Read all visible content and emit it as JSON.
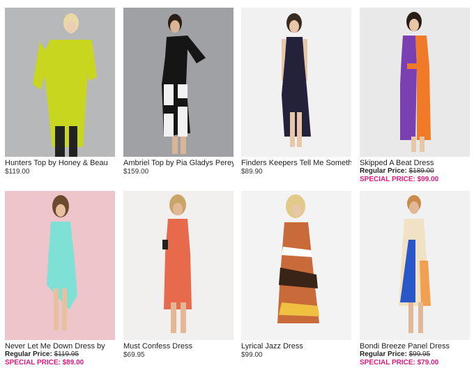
{
  "products": [
    {
      "name": "Hunters Top by Honey & Beau",
      "price": "$119.00",
      "bg": "#b7b8ba",
      "garment": "#c8d620",
      "legs": "#222222",
      "hair": "#e9d9a4"
    },
    {
      "name": "Ambriel Top by Pia Gladys Perey",
      "price": "$159.00",
      "bg": "#9fa1a4",
      "garment": "#151515",
      "legs": "#f2f2f2",
      "hair": "#2a1d16"
    },
    {
      "name": "Finders Keepers Tell Me Something",
      "price": "$89.90",
      "bg": "#f1f1f1",
      "garment": "#24223a",
      "legs": "#e8c6a8",
      "hair": "#3a2a20"
    },
    {
      "name": "Skipped A Beat Dress",
      "regular_label": "Regular Price:",
      "regular_price": "$189.00",
      "special_label": "SPECIAL PRICE:",
      "special_price": "$99.00",
      "bg": "#e9e9ea",
      "garment": "#7a3fb0",
      "accent": "#f07a28",
      "legs": "#e8c6a8",
      "hair": "#2a1d16"
    },
    {
      "name": "Never Let Me Down Dress by",
      "regular_label": "Regular Price:",
      "regular_price": "$119.95",
      "special_label": "SPECIAL PRICE:",
      "special_price": "$89.00",
      "bg": "#efc5cc",
      "garment": "#7fe0d6",
      "legs": "#e8c0a0",
      "hair": "#6b4a2e"
    },
    {
      "name": "Must Confess Dress",
      "price": "$69.95",
      "bg": "#f2f0ee",
      "garment": "#e86a4c",
      "legs": "#e3b896",
      "hair": "#c9a56a"
    },
    {
      "name": "Lyrical Jazz Dress",
      "price": "$99.00",
      "bg": "#f3f3f3",
      "garment": "#c86a3a",
      "accent": "#3a2418",
      "legs": "#e8c6a8",
      "hair": "#e1c98a"
    },
    {
      "name": "Bondi Breeze Panel Dress",
      "regular_label": "Regular Price:",
      "regular_price": "$99.95",
      "special_label": "SPECIAL PRICE:",
      "special_price": "$79.00",
      "bg": "#f1f1f1",
      "garment": "#f1e2c6",
      "accent": "#2a57c8",
      "accent2": "#f0a050",
      "legs": "#e3b896",
      "hair": "#c98a4a"
    }
  ],
  "colors": {
    "special": "#e0197d"
  }
}
